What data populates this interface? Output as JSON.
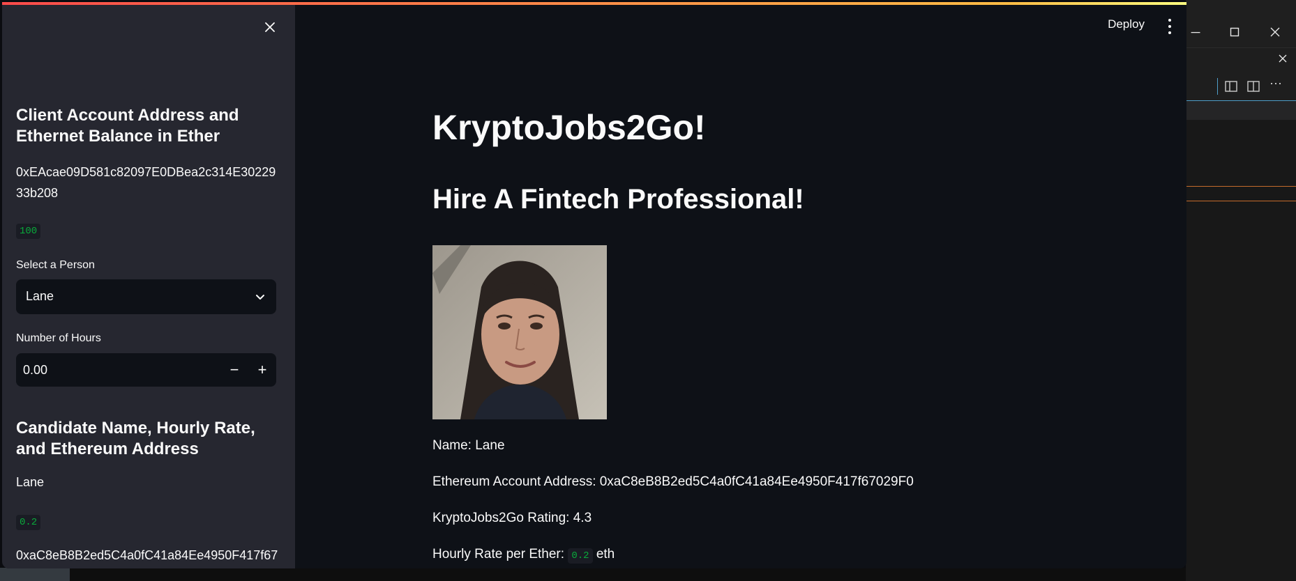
{
  "sidebar": {
    "client_heading": "Client Account Address and Ethernet Balance in Ether",
    "client_address": "0xEAcae09D581c82097E0DBea2c314E3022933b208",
    "client_balance": "100",
    "select_label": "Select a Person",
    "selected_person": "Lane",
    "hours_label": "Number of Hours",
    "hours_value": "0.00",
    "minus_symbol": "−",
    "plus_symbol": "+",
    "candidate_heading": "Candidate Name, Hourly Rate, and Ethereum Address",
    "candidate_name": "Lane",
    "candidate_rate": "0.2",
    "candidate_address": "0xaC8eB8B2ed5C4a0fC41a84Ee4950F417f67"
  },
  "header": {
    "deploy_label": "Deploy"
  },
  "main": {
    "title": "KryptoJobs2Go!",
    "subtitle": "Hire A Fintech Professional!",
    "name_line": "Name: Lane",
    "address_line": "Ethereum Account Address: 0xaC8eB8B2ed5C4a0fC41a84Ee4950F417f67029F0",
    "rating_line": "KryptoJobs2Go Rating: 4.3",
    "rate_prefix": "Hourly Rate per Ether:",
    "rate_value": "0.2",
    "rate_suffix": "eth"
  },
  "colors": {
    "accent_green": "#09ab3b",
    "sidebar_bg": "#262730",
    "main_bg": "#0e1117"
  },
  "icons": {
    "close": "close-icon",
    "dropdown": "chevron-down-icon",
    "menu": "kebab-menu-icon"
  }
}
